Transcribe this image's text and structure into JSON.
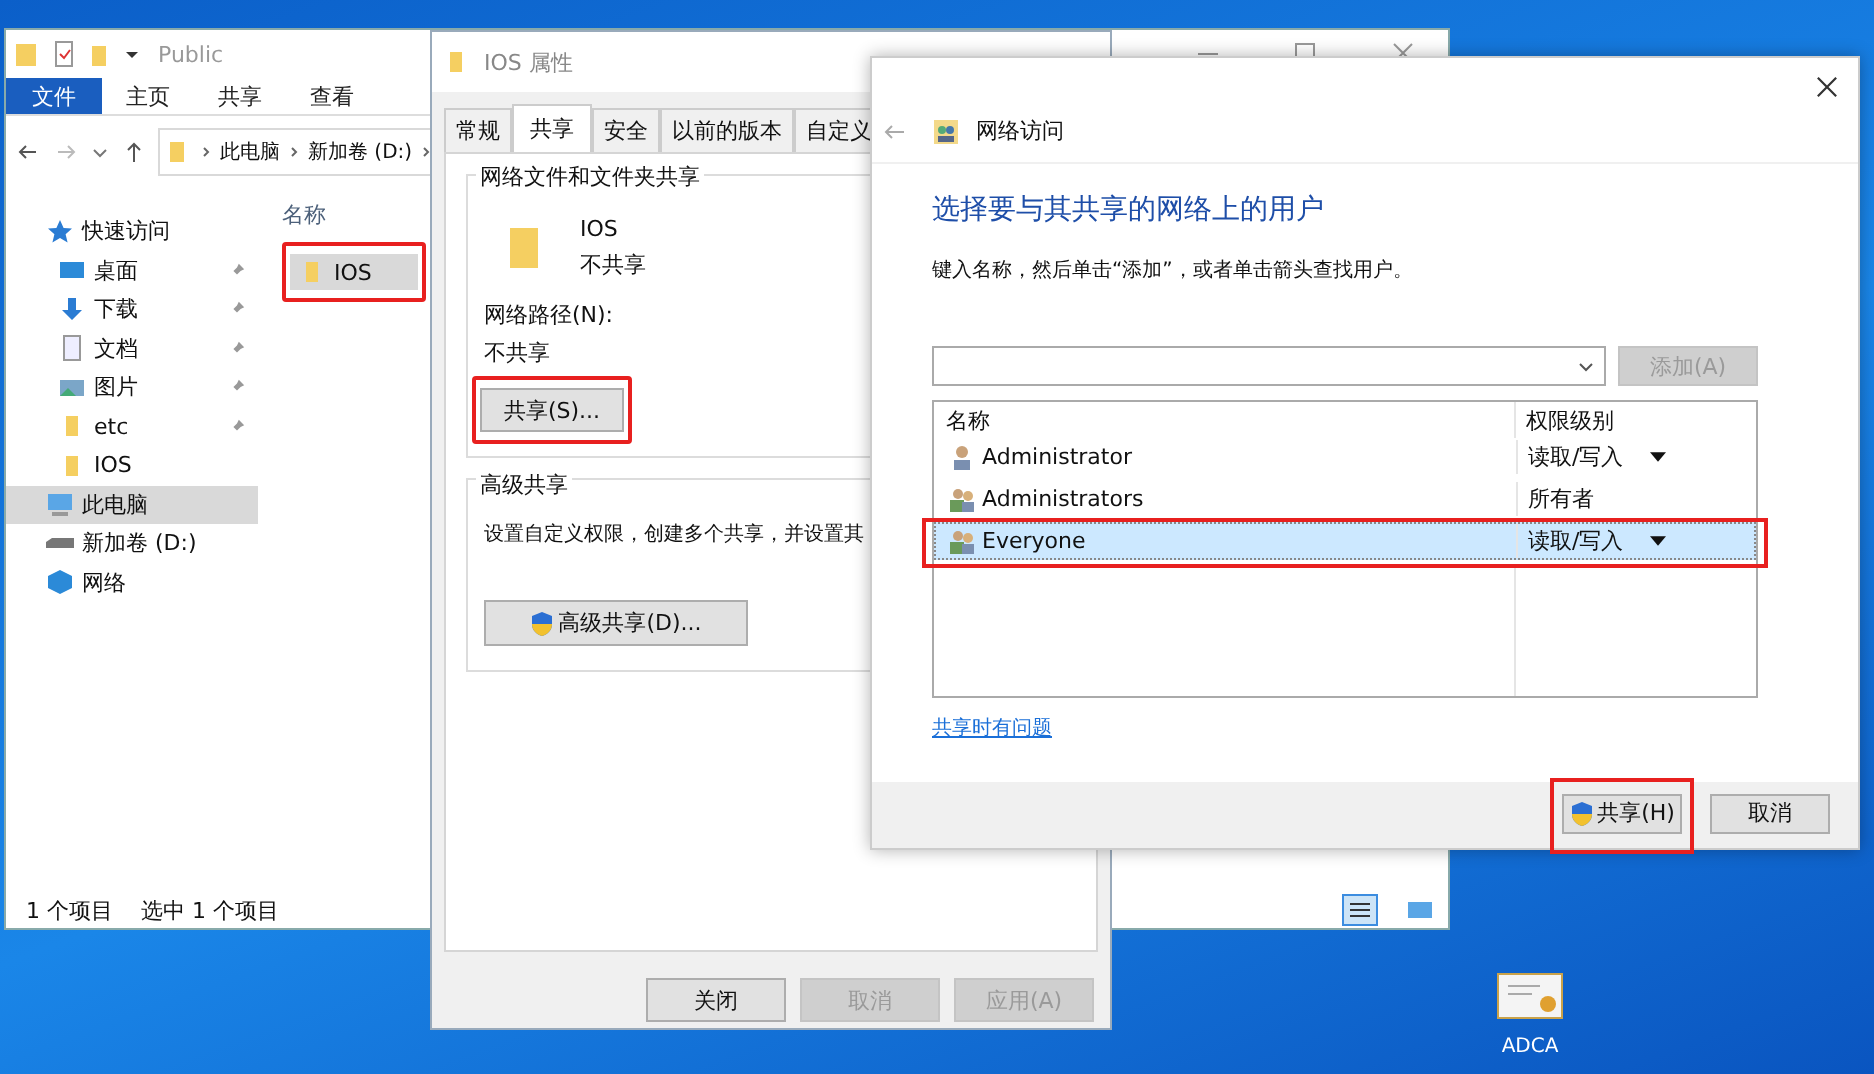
{
  "explorer": {
    "title": "Public",
    "ribbon_tabs": [
      {
        "label": "文件",
        "selected": true
      },
      {
        "label": "主页",
        "selected": false
      },
      {
        "label": "共享",
        "selected": false
      },
      {
        "label": "查看",
        "selected": false
      }
    ],
    "breadcrumb": [
      "此电脑",
      "新加卷 (D:)"
    ],
    "nav": [
      {
        "label": "快速访问",
        "kind": "star",
        "selected": false,
        "children": [
          {
            "label": "桌面",
            "kind": "desktop",
            "pinned": true,
            "selected": false
          },
          {
            "label": "下载",
            "kind": "download",
            "pinned": true,
            "selected": false
          },
          {
            "label": "文档",
            "kind": "document",
            "pinned": true,
            "selected": false
          },
          {
            "label": "图片",
            "kind": "picture",
            "pinned": true,
            "selected": false
          },
          {
            "label": "etc",
            "kind": "folder",
            "pinned": true,
            "selected": false
          },
          {
            "label": "IOS",
            "kind": "folder",
            "pinned": false,
            "selected": false
          }
        ]
      },
      {
        "label": "此电脑",
        "kind": "pc",
        "selected": true
      },
      {
        "label": "新加卷 (D:)",
        "kind": "drive",
        "selected": false
      },
      {
        "label": "网络",
        "kind": "network",
        "selected": false
      }
    ],
    "column_header": "名称",
    "files": [
      {
        "name": "IOS",
        "selected": true,
        "highlighted": true
      }
    ],
    "status": [
      "1 个项目",
      "选中 1 个项目"
    ]
  },
  "properties": {
    "title": "IOS 属性",
    "tabs": [
      {
        "label": "常规",
        "selected": false
      },
      {
        "label": "共享",
        "selected": true
      },
      {
        "label": "安全",
        "selected": false
      },
      {
        "label": "以前的版本",
        "selected": false
      },
      {
        "label": "自定义",
        "selected": false
      }
    ],
    "network_section": {
      "title": "网络文件和文件夹共享",
      "folder_name": "IOS",
      "folder_status": "不共享",
      "path_label": "网络路径(N):",
      "path_value": "不共享",
      "share_button": {
        "label": "共享(S)...",
        "highlighted": true
      }
    },
    "advanced_section": {
      "title": "高级共享",
      "text": "设置自定义权限，创建多个共享，并设置其",
      "button": "高级共享(D)..."
    },
    "buttons": [
      {
        "label": "关闭",
        "disabled": false
      },
      {
        "label": "取消",
        "disabled": true
      },
      {
        "label": "应用(A)",
        "disabled": true
      }
    ]
  },
  "network_access": {
    "title": "网络访问",
    "heading": "选择要与其共享的网络上的用户",
    "instruction": "键入名称，然后单击“添加”，或者单击箭头查找用户。",
    "add_button": {
      "label": "添加(A)",
      "disabled": true
    },
    "columns": [
      "名称",
      "权限级别"
    ],
    "users": [
      {
        "name": "Administrator",
        "kind": "user",
        "permission": "读取/写入",
        "dropdown": true,
        "selected": false,
        "highlighted": false
      },
      {
        "name": "Administrators",
        "kind": "group",
        "permission": "所有者",
        "dropdown": false,
        "selected": false,
        "highlighted": false
      },
      {
        "name": "Everyone",
        "kind": "group",
        "permission": "读取/写入",
        "dropdown": true,
        "selected": true,
        "highlighted": true
      }
    ],
    "link": "共享时有问题",
    "buttons": [
      {
        "label": "共享(H)",
        "shield": true,
        "highlighted": true
      },
      {
        "label": "取消",
        "shield": false,
        "highlighted": false
      }
    ]
  },
  "desktop_icons": [
    {
      "label": "ADCA"
    }
  ]
}
